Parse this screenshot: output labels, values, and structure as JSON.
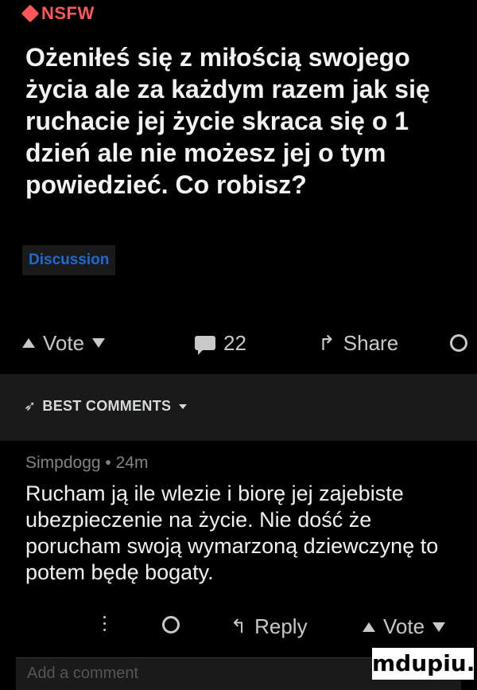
{
  "post": {
    "nsfw_label": "NSFW",
    "title": "Ożeniłeś się z miłością swojego życia ale za każdym razem jak się ruchacie jej życie skraca się o 1 dzień ale nie możesz jej o tym powiedzieć. Co robisz?",
    "flair": "Discussion"
  },
  "actions": {
    "vote_label": "Vote",
    "comment_count": "22",
    "share_label": "Share"
  },
  "best_comments": {
    "label": "BEST COMMENTS"
  },
  "comment": {
    "author": "Simpdogg",
    "age": "24m",
    "text": "Rucham ją ile wlezie i biorę jej zajebiste ubezpieczenie na życie. Nie dość że porucham swoją wymarzoną dziewczynę to potem będę bogaty.",
    "reply_label": "Reply",
    "vote_label": "Vote"
  },
  "footer": {
    "add_comment_placeholder": "Add a comment",
    "watermark": "mdupiu.pl"
  },
  "colors": {
    "background": "#000000",
    "nsfw": "#ff585b",
    "flair_text": "#1f6bd1",
    "meta": "#818384"
  }
}
